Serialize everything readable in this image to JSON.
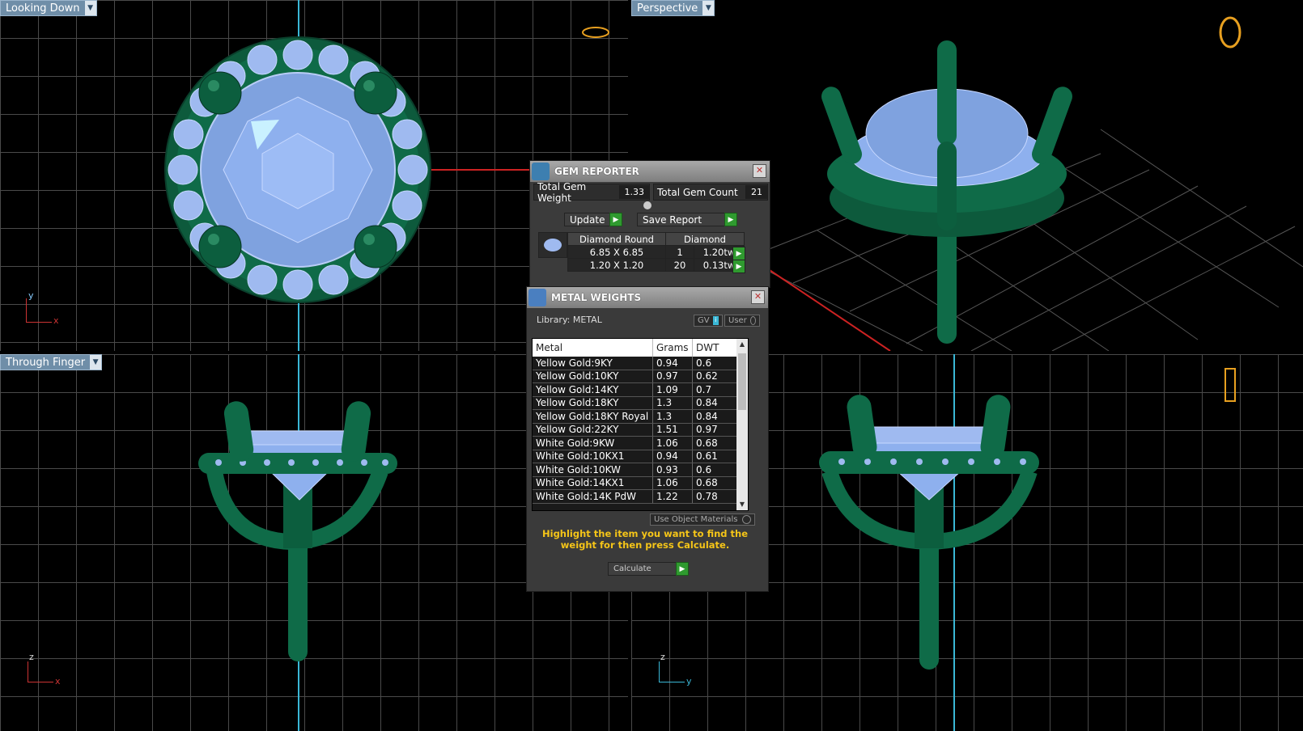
{
  "viewports": {
    "top_left": {
      "label": "Looking Down",
      "axis_u": "y",
      "axis_l": "x"
    },
    "top_right": {
      "label": "Perspective"
    },
    "bottom_left": {
      "label": "Through Finger",
      "axis_u": "z",
      "axis_l": "x"
    },
    "bottom_right": {
      "axis_u": "z",
      "axis_l": "y"
    }
  },
  "gem_reporter": {
    "title": "GEM REPORTER",
    "total_weight_label": "Total Gem Weight",
    "total_weight": "1.33",
    "total_count_label": "Total Gem Count",
    "total_count": "21",
    "update_label": "Update",
    "save_label": "Save Report",
    "table_headers": [
      "Diamond Round",
      "Diamond"
    ],
    "rows": [
      {
        "size": "6.85 X 6.85",
        "count": "1",
        "weight": "1.20tw"
      },
      {
        "size": "1.20 X 1.20",
        "count": "20",
        "weight": "0.13tw"
      }
    ]
  },
  "metal_weights": {
    "title": "METAL WEIGHTS",
    "library": "Library: METAL",
    "gv_label": "GV",
    "user_label": "User",
    "headers": [
      "Metal",
      "Grams",
      "DWT"
    ],
    "rows": [
      [
        "Yellow Gold:9KY",
        "0.94",
        "0.6"
      ],
      [
        "Yellow Gold:10KY",
        "0.97",
        "0.62"
      ],
      [
        "Yellow Gold:14KY",
        "1.09",
        "0.7"
      ],
      [
        "Yellow Gold:18KY",
        "1.3",
        "0.84"
      ],
      [
        "Yellow Gold:18KY Royal",
        "1.3",
        "0.84"
      ],
      [
        "Yellow Gold:22KY",
        "1.51",
        "0.97"
      ],
      [
        "White Gold:9KW",
        "1.06",
        "0.68"
      ],
      [
        "White Gold:10KX1",
        "0.94",
        "0.61"
      ],
      [
        "White Gold:10KW",
        "0.93",
        "0.6"
      ],
      [
        "White Gold:14KX1",
        "1.06",
        "0.68"
      ],
      [
        "White Gold:14K PdW",
        "1.22",
        "0.78"
      ]
    ],
    "use_object_materials": "Use Object Materials",
    "hint": "Highlight the item you want to find the weight for then press Calculate.",
    "calculate_label": "Calculate"
  },
  "colors": {
    "metal": "#0f6b48",
    "gem": "#8fb0ea",
    "axis": "#3ab7d6",
    "label_bg": "#6f8ea8"
  }
}
